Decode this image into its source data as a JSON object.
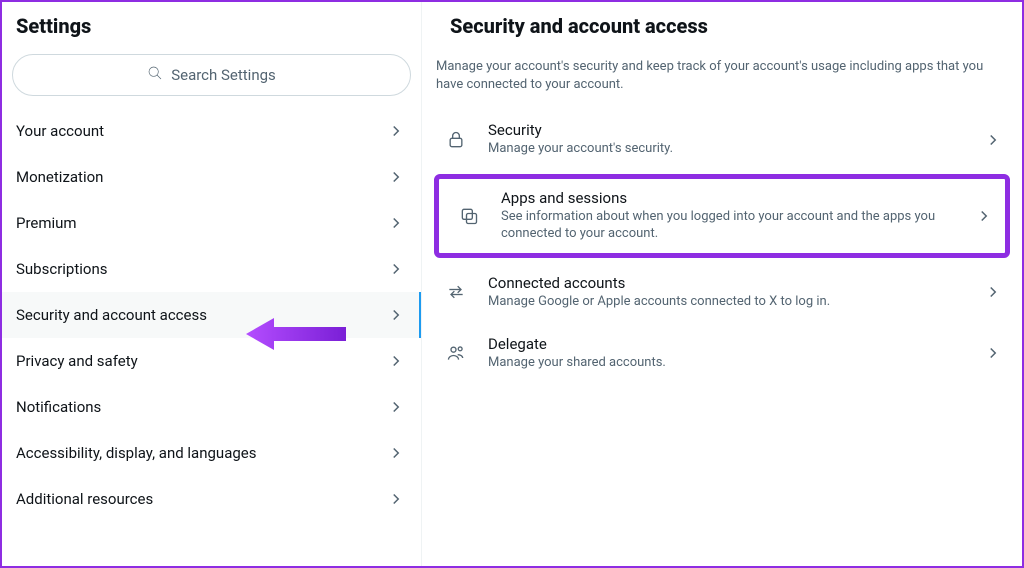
{
  "sidebar": {
    "title": "Settings",
    "search_placeholder": "Search Settings",
    "items": [
      {
        "label": "Your account"
      },
      {
        "label": "Monetization"
      },
      {
        "label": "Premium"
      },
      {
        "label": "Subscriptions"
      },
      {
        "label": "Security and account access"
      },
      {
        "label": "Privacy and safety"
      },
      {
        "label": "Notifications"
      },
      {
        "label": "Accessibility, display, and languages"
      },
      {
        "label": "Additional resources"
      }
    ],
    "active_index": 4
  },
  "main": {
    "title": "Security and account access",
    "description": "Manage your account's security and keep track of your account's usage including apps that you have connected to your account.",
    "options": [
      {
        "title": "Security",
        "subtitle": "Manage your account's security."
      },
      {
        "title": "Apps and sessions",
        "subtitle": "See information about when you logged into your account and the apps you connected to your account."
      },
      {
        "title": "Connected accounts",
        "subtitle": "Manage Google or Apple accounts connected to X to log in."
      },
      {
        "title": "Delegate",
        "subtitle": "Manage your shared accounts."
      }
    ],
    "highlight_index": 1
  },
  "colors": {
    "accent": "#8e2de2",
    "link": "#1d9bf0"
  }
}
